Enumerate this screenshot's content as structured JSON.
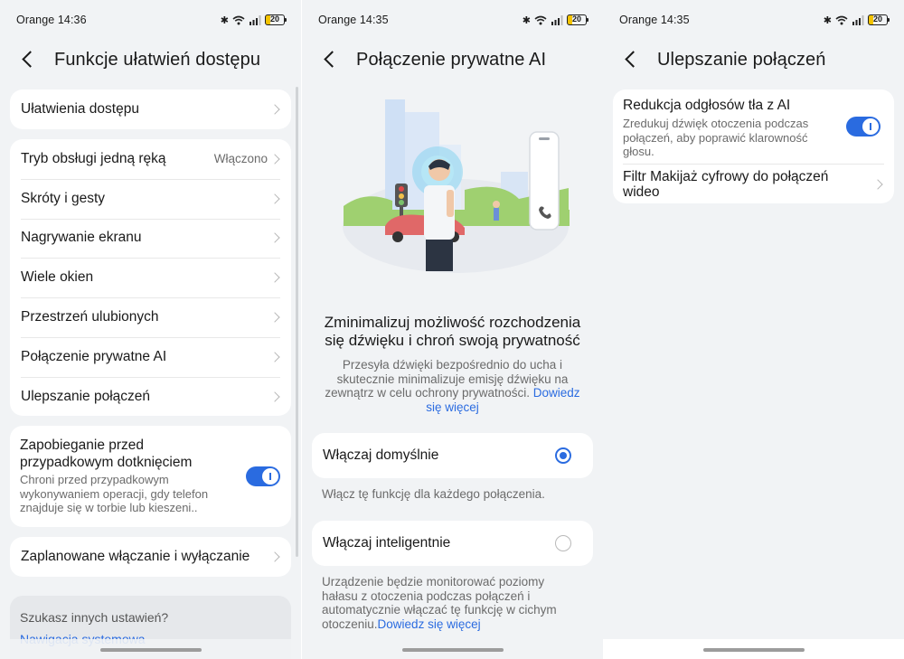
{
  "panel1": {
    "status": {
      "carrier": "Orange",
      "time": "14:36",
      "battery": "20"
    },
    "title": "Funkcje ułatwień dostępu",
    "accessibility_row": "Ułatwienia dostępu",
    "group_items": [
      {
        "label": "Tryb obsługi jedną ręką",
        "value": "Włączono"
      },
      {
        "label": "Skróty i gesty"
      },
      {
        "label": "Nagrywanie ekranu"
      },
      {
        "label": "Wiele okien"
      },
      {
        "label": "Przestrzeń ulubionych"
      },
      {
        "label": "Połączenie prywatne AI"
      },
      {
        "label": "Ulepszanie połączeń"
      }
    ],
    "accidental_touch": {
      "title": "Zapobieganie przed przypadkowym dotknięciem",
      "description": "Chroni przed przypadkowym wykonywaniem operacji, gdy telefon znajduje się w torbie lub kieszeni..",
      "enabled": true
    },
    "scheduled": "Zaplanowane włączanie i wyłączanie",
    "search_prompt": "Szukasz innych ustawień?",
    "search_link": "Nawigacja systemowa"
  },
  "panel2": {
    "status": {
      "carrier": "Orange",
      "time": "14:35",
      "battery": "20"
    },
    "title": "Połączenie prywatne AI",
    "headline": "Zminimalizuj możliwość rozchodzenia się dźwięku i chroń swoją prywatność",
    "body": "Przesyła dźwięki bezpośrednio do ucha i skutecznie minimalizuje emisję dźwięku na zewnątrz w celu ochrony prywatności.",
    "learn_more": "Dowiedz się więcej",
    "option_default": {
      "label": "Włączaj domyślnie",
      "selected": true,
      "caption": "Włącz tę funkcję dla każdego połączenia."
    },
    "option_smart": {
      "label": "Włączaj inteligentnie",
      "selected": false,
      "caption": "Urządzenie będzie monitorować poziomy hałasu z otoczenia podczas połączeń i automatycznie włączać tę funkcję w cichym otoczeniu.",
      "learn_more": "Dowiedz się więcej"
    }
  },
  "panel3": {
    "status": {
      "carrier": "Orange",
      "time": "14:35",
      "battery": "20"
    },
    "title": "Ulepszanie połączeń",
    "noise": {
      "title": "Redukcja odgłosów tła z AI",
      "description": "Zredukuj dźwięk otoczenia podczas połączeń, aby poprawić klarowność głosu.",
      "enabled": true
    },
    "makeup": "Filtr Makijaż cyfrowy do połączeń wideo"
  },
  "colors": {
    "accent": "#2a6be0",
    "background": "#f1f3f5",
    "card": "#ffffff"
  }
}
